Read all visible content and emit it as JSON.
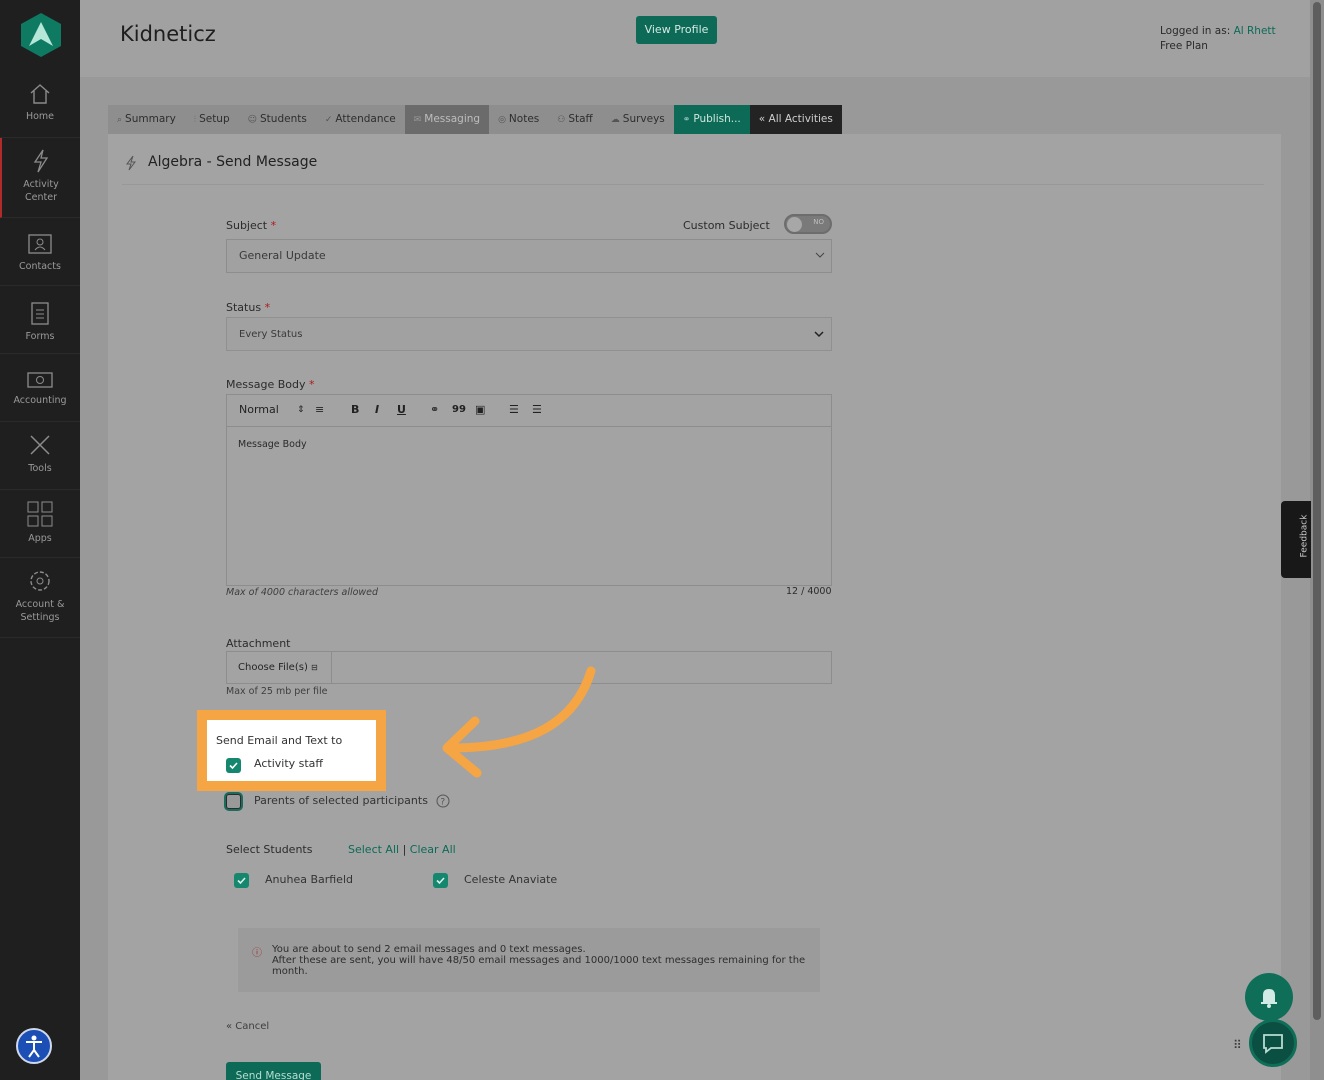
{
  "sidebar": {
    "items": [
      {
        "label": "Home",
        "icon": "home-icon"
      },
      {
        "label": "Activity Center",
        "icon": "bolt-icon"
      },
      {
        "label": "Contacts",
        "icon": "contacts-icon"
      },
      {
        "label": "Forms",
        "icon": "clipboard-icon"
      },
      {
        "label": "Accounting",
        "icon": "money-icon"
      },
      {
        "label": "Tools",
        "icon": "tools-icon"
      },
      {
        "label": "Apps",
        "icon": "apps-icon"
      },
      {
        "label": "Account & Settings",
        "icon": "gear-icon"
      }
    ]
  },
  "header": {
    "brand": "Kidneticz",
    "view_profile": "View Profile",
    "logged_in_label": "Logged in as:",
    "user": "Al Rhett",
    "plan": "Free Plan"
  },
  "tabs": [
    {
      "label": "Summary",
      "icon": "summary-icon"
    },
    {
      "label": "Setup",
      "icon": "setup-icon"
    },
    {
      "label": "Students",
      "icon": "students-icon"
    },
    {
      "label": "Attendance",
      "icon": "check-icon"
    },
    {
      "label": "Messaging",
      "icon": "mail-icon"
    },
    {
      "label": "Notes",
      "icon": "notes-icon"
    },
    {
      "label": "Staff",
      "icon": "staff-icon"
    },
    {
      "label": "Surveys",
      "icon": "cloud-icon"
    },
    {
      "label": "Publish...",
      "icon": "link-icon"
    },
    {
      "label": "« All Activities",
      "icon": ""
    }
  ],
  "page": {
    "title": "Algebra - Send Message"
  },
  "form": {
    "subject_label": "Subject",
    "custom_subject_label": "Custom Subject",
    "custom_subject_toggle": "NO",
    "subject_value": "General Update",
    "status_label": "Status",
    "status_value": "Every Status",
    "body_label": "Message Body",
    "toolbar": {
      "format": "Normal",
      "bold": "B",
      "italic": "I",
      "underline": "U",
      "quote": "99"
    },
    "body_text": "Message Body",
    "max_chars": "Max of 4000 characters allowed",
    "char_count": "12 / 4000",
    "attachment_label": "Attachment",
    "choose_files": "Choose File(s)",
    "max_size": "Max of 25 mb per file",
    "send_to_label": "Send Email and Text to",
    "activity_staff": "Activity staff",
    "parents_label": "Parents of selected participants",
    "select_students_label": "Select Students",
    "select_all": "Select All",
    "separator": "|",
    "clear_all": "Clear All",
    "students": [
      "Anuhea Barfield",
      "Celeste Anaviate"
    ],
    "notice_line1": "You are about to send 2 email messages and 0 text messages.",
    "notice_line2": "After these are sent, you will have 48/50 email messages and 1000/1000 text messages remaining for the month.",
    "cancel": "« Cancel",
    "send": "Send Message"
  },
  "feedback": "Feedback",
  "colors": {
    "accent": "#0c6a56",
    "highlight": "#f5a544",
    "sidebar": "#1f1f1f"
  }
}
